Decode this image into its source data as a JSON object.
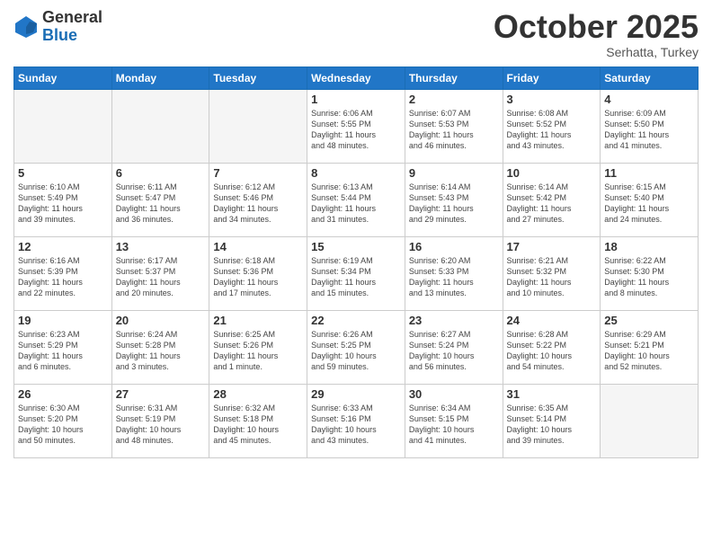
{
  "logo": {
    "general": "General",
    "blue": "Blue"
  },
  "header": {
    "month": "October 2025",
    "location": "Serhatta, Turkey"
  },
  "days_of_week": [
    "Sunday",
    "Monday",
    "Tuesday",
    "Wednesday",
    "Thursday",
    "Friday",
    "Saturday"
  ],
  "weeks": [
    [
      {
        "day": "",
        "info": ""
      },
      {
        "day": "",
        "info": ""
      },
      {
        "day": "",
        "info": ""
      },
      {
        "day": "1",
        "info": "Sunrise: 6:06 AM\nSunset: 5:55 PM\nDaylight: 11 hours\nand 48 minutes."
      },
      {
        "day": "2",
        "info": "Sunrise: 6:07 AM\nSunset: 5:53 PM\nDaylight: 11 hours\nand 46 minutes."
      },
      {
        "day": "3",
        "info": "Sunrise: 6:08 AM\nSunset: 5:52 PM\nDaylight: 11 hours\nand 43 minutes."
      },
      {
        "day": "4",
        "info": "Sunrise: 6:09 AM\nSunset: 5:50 PM\nDaylight: 11 hours\nand 41 minutes."
      }
    ],
    [
      {
        "day": "5",
        "info": "Sunrise: 6:10 AM\nSunset: 5:49 PM\nDaylight: 11 hours\nand 39 minutes."
      },
      {
        "day": "6",
        "info": "Sunrise: 6:11 AM\nSunset: 5:47 PM\nDaylight: 11 hours\nand 36 minutes."
      },
      {
        "day": "7",
        "info": "Sunrise: 6:12 AM\nSunset: 5:46 PM\nDaylight: 11 hours\nand 34 minutes."
      },
      {
        "day": "8",
        "info": "Sunrise: 6:13 AM\nSunset: 5:44 PM\nDaylight: 11 hours\nand 31 minutes."
      },
      {
        "day": "9",
        "info": "Sunrise: 6:14 AM\nSunset: 5:43 PM\nDaylight: 11 hours\nand 29 minutes."
      },
      {
        "day": "10",
        "info": "Sunrise: 6:14 AM\nSunset: 5:42 PM\nDaylight: 11 hours\nand 27 minutes."
      },
      {
        "day": "11",
        "info": "Sunrise: 6:15 AM\nSunset: 5:40 PM\nDaylight: 11 hours\nand 24 minutes."
      }
    ],
    [
      {
        "day": "12",
        "info": "Sunrise: 6:16 AM\nSunset: 5:39 PM\nDaylight: 11 hours\nand 22 minutes."
      },
      {
        "day": "13",
        "info": "Sunrise: 6:17 AM\nSunset: 5:37 PM\nDaylight: 11 hours\nand 20 minutes."
      },
      {
        "day": "14",
        "info": "Sunrise: 6:18 AM\nSunset: 5:36 PM\nDaylight: 11 hours\nand 17 minutes."
      },
      {
        "day": "15",
        "info": "Sunrise: 6:19 AM\nSunset: 5:34 PM\nDaylight: 11 hours\nand 15 minutes."
      },
      {
        "day": "16",
        "info": "Sunrise: 6:20 AM\nSunset: 5:33 PM\nDaylight: 11 hours\nand 13 minutes."
      },
      {
        "day": "17",
        "info": "Sunrise: 6:21 AM\nSunset: 5:32 PM\nDaylight: 11 hours\nand 10 minutes."
      },
      {
        "day": "18",
        "info": "Sunrise: 6:22 AM\nSunset: 5:30 PM\nDaylight: 11 hours\nand 8 minutes."
      }
    ],
    [
      {
        "day": "19",
        "info": "Sunrise: 6:23 AM\nSunset: 5:29 PM\nDaylight: 11 hours\nand 6 minutes."
      },
      {
        "day": "20",
        "info": "Sunrise: 6:24 AM\nSunset: 5:28 PM\nDaylight: 11 hours\nand 3 minutes."
      },
      {
        "day": "21",
        "info": "Sunrise: 6:25 AM\nSunset: 5:26 PM\nDaylight: 11 hours\nand 1 minute."
      },
      {
        "day": "22",
        "info": "Sunrise: 6:26 AM\nSunset: 5:25 PM\nDaylight: 10 hours\nand 59 minutes."
      },
      {
        "day": "23",
        "info": "Sunrise: 6:27 AM\nSunset: 5:24 PM\nDaylight: 10 hours\nand 56 minutes."
      },
      {
        "day": "24",
        "info": "Sunrise: 6:28 AM\nSunset: 5:22 PM\nDaylight: 10 hours\nand 54 minutes."
      },
      {
        "day": "25",
        "info": "Sunrise: 6:29 AM\nSunset: 5:21 PM\nDaylight: 10 hours\nand 52 minutes."
      }
    ],
    [
      {
        "day": "26",
        "info": "Sunrise: 6:30 AM\nSunset: 5:20 PM\nDaylight: 10 hours\nand 50 minutes."
      },
      {
        "day": "27",
        "info": "Sunrise: 6:31 AM\nSunset: 5:19 PM\nDaylight: 10 hours\nand 48 minutes."
      },
      {
        "day": "28",
        "info": "Sunrise: 6:32 AM\nSunset: 5:18 PM\nDaylight: 10 hours\nand 45 minutes."
      },
      {
        "day": "29",
        "info": "Sunrise: 6:33 AM\nSunset: 5:16 PM\nDaylight: 10 hours\nand 43 minutes."
      },
      {
        "day": "30",
        "info": "Sunrise: 6:34 AM\nSunset: 5:15 PM\nDaylight: 10 hours\nand 41 minutes."
      },
      {
        "day": "31",
        "info": "Sunrise: 6:35 AM\nSunset: 5:14 PM\nDaylight: 10 hours\nand 39 minutes."
      },
      {
        "day": "",
        "info": ""
      }
    ]
  ]
}
